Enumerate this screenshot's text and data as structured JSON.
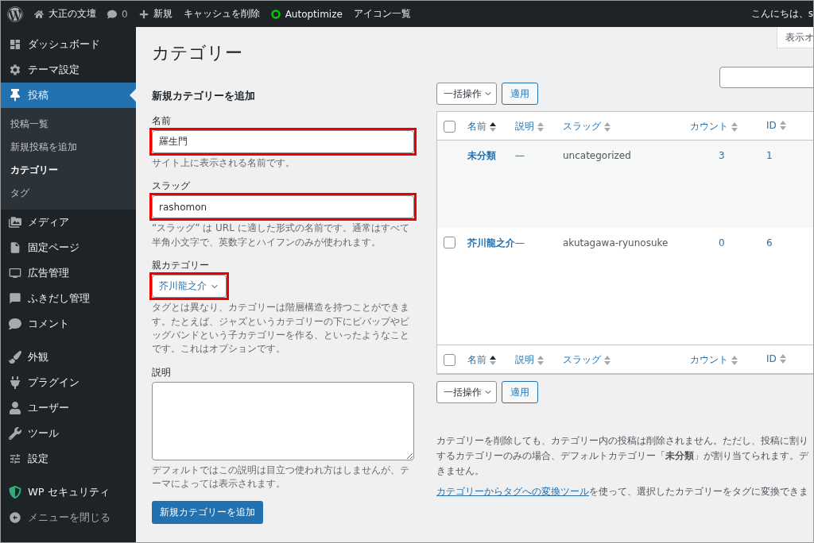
{
  "admin_bar": {
    "site": "大正の文壇",
    "comments": "0",
    "new": "新規",
    "items": [
      "キャッシュを削除",
      "Autoptimize",
      "アイコン一覧"
    ],
    "greeting": "こんにちは、s"
  },
  "sidebar": {
    "groups": [
      [
        {
          "label": "ダッシュボード",
          "selected": false
        },
        {
          "label": "テーマ設定",
          "selected": false
        },
        {
          "label": "投稿",
          "selected": true,
          "children": [
            {
              "label": "投稿一覧",
              "selected": false
            },
            {
              "label": "新規投稿を追加",
              "selected": false
            },
            {
              "label": "カテゴリー",
              "selected": true
            },
            {
              "label": "タグ",
              "selected": false
            }
          ]
        },
        {
          "label": "メディア",
          "selected": false
        },
        {
          "label": "固定ページ",
          "selected": false
        },
        {
          "label": "広告管理",
          "selected": false
        },
        {
          "label": "ふきだし管理",
          "selected": false
        },
        {
          "label": "コメント",
          "selected": false
        }
      ],
      [
        {
          "label": "外観",
          "selected": false
        },
        {
          "label": "プラグイン",
          "selected": false
        },
        {
          "label": "ユーザー",
          "selected": false
        },
        {
          "label": "ツール",
          "selected": false
        },
        {
          "label": "設定",
          "selected": false
        }
      ],
      [
        {
          "label": "WP セキュリティ",
          "selected": false
        },
        {
          "label": "メニューを閉じる",
          "selected": false
        }
      ]
    ]
  },
  "page": {
    "title": "カテゴリー",
    "screen_options": "表示オ"
  },
  "form": {
    "heading": "新規カテゴリーを追加",
    "fields": [
      {
        "kind": "text",
        "label": "名前",
        "value": "羅生門",
        "help": "サイト上に表示される名前です。",
        "highlighted": true
      },
      {
        "kind": "text",
        "label": "スラッグ",
        "value": "rashomon",
        "help": "“スラッグ” は URL に適した形式の名前です。通常はすべて半角小文字で、英数字とハイフンのみが使われます。",
        "highlighted": true
      },
      {
        "kind": "select",
        "label": "親カテゴリー",
        "value": "芥川龍之介",
        "help": "タグとは異なり、カテゴリーは階層構造を持つことができます。たとえば、ジャズというカテゴリーの下にビバップやビッグバンドという子カテゴリーを作る、といったようなことです。これはオプションです。",
        "highlighted": true
      },
      {
        "kind": "textarea",
        "label": "説明",
        "help": "デフォルトではこの説明は目立つ使われ方はしませんが、テーマによっては表示されます。",
        "highlighted": false
      }
    ],
    "submit": "新規カテゴリーを追加"
  },
  "table": {
    "top_tools": {
      "bulk_action": "一括操作",
      "apply": "適用"
    },
    "header": {
      "checked": false,
      "columns": [
        {
          "label": "名前",
          "sorted": true
        },
        {
          "label": "説明",
          "sorted": false
        },
        {
          "label": "スラッグ",
          "sorted": false
        },
        {
          "label": "カウント",
          "sorted": false
        },
        {
          "label": "ID",
          "sorted": false
        }
      ]
    },
    "footer": {
      "checked": false,
      "columns": [
        {
          "label": "名前",
          "sorted": true
        },
        {
          "label": "説明",
          "sorted": false
        },
        {
          "label": "スラッグ",
          "sorted": false
        },
        {
          "label": "カウント",
          "sorted": false
        },
        {
          "label": "ID",
          "sorted": false
        }
      ]
    },
    "bottom_tools": {
      "bulk_action": "一括操作",
      "apply": "適用"
    },
    "rows": [
      {
        "kind": "default",
        "name": "未分類",
        "description": "—",
        "slug": "uncategorized",
        "count": "3",
        "id": "1"
      },
      {
        "kind": "normal",
        "checked": false,
        "name": "芥川龍之介",
        "description": "—",
        "slug": "akutagawa-ryunosuke",
        "count": "0",
        "id": "6"
      }
    ]
  },
  "notes": {
    "lines": [
      "カテゴリーを削除しても、カテゴリー内の投稿は削除されません。ただし、投稿に割り",
      "するカテゴリーのみの場合、デフォルトカテゴリー「**未分類**」が割り当てられます。デ",
      "きません。"
    ],
    "link": "カテゴリーからタグへの変換ツール",
    "link_rest": "を使って、選択したカテゴリーをタグに変換できま"
  }
}
